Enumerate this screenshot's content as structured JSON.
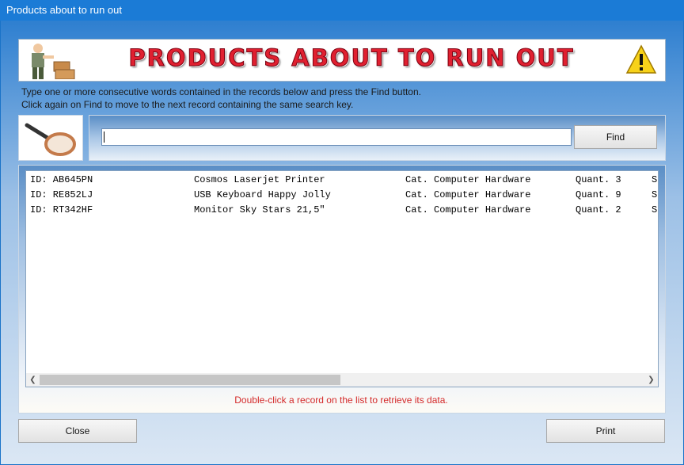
{
  "window": {
    "title": "Products about to run out"
  },
  "banner": {
    "title": "PRODUCTS ABOUT TO RUN OUT"
  },
  "instructions": {
    "line1": "Type one or more consecutive words contained in the records below and press the Find button.",
    "line2": "Click again on Find to move to the next record containing the same search key."
  },
  "search": {
    "value": "",
    "find_label": "Find"
  },
  "records": [
    {
      "id": "ID: AB645PN",
      "name": "Cosmos Laserjet Printer",
      "category": "Cat. Computer Hardware",
      "quantity": "Quant. 3",
      "extra": "S"
    },
    {
      "id": "ID: RE852LJ",
      "name": "USB Keyboard Happy Jolly",
      "category": "Cat. Computer Hardware",
      "quantity": "Quant. 9",
      "extra": "S"
    },
    {
      "id": "ID: RT342HF",
      "name": "Monitor Sky Stars 21,5\"",
      "category": "Cat. Computer Hardware",
      "quantity": "Quant. 2",
      "extra": "S"
    }
  ],
  "hint": "Double-click a record on the list to retrieve its data.",
  "buttons": {
    "close": "Close",
    "print": "Print"
  },
  "colors": {
    "titlebar": "#1b7bd6",
    "banner_text": "#e02030",
    "hint_text": "#d42a2a"
  },
  "icons": {
    "banner_left": "man-with-boxes-icon",
    "banner_right": "warning-icon",
    "search": "magnifying-glass-icon"
  }
}
